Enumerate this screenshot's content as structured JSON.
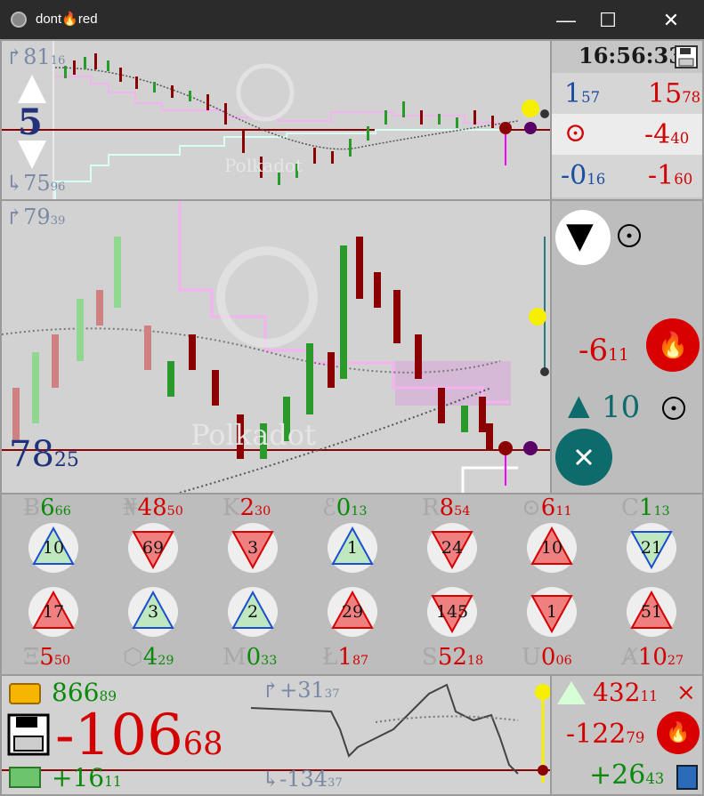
{
  "window": {
    "title": "dont🔥red",
    "controls": {
      "minimize": "—",
      "maximize": "☐",
      "close": "✕"
    }
  },
  "top_panel": {
    "hi_label": "↱81",
    "hi_sub": "16",
    "lo_label": "↳75",
    "lo_sub": "96",
    "interval": "5",
    "watermark": "Polkadot",
    "clock": "16:56:33",
    "stats": [
      {
        "a": "1",
        "a_sub": "57",
        "b": "15",
        "b_sub": "78"
      },
      {
        "a": "⊙",
        "a_sub": "",
        "b": "-4",
        "b_sub": "40"
      },
      {
        "a": "-0",
        "a_sub": "16",
        "b": "-1",
        "b_sub": "60"
      }
    ]
  },
  "main_panel": {
    "hi_label": "↱79",
    "hi_sub": "39",
    "price": "78",
    "price_sub": "25",
    "watermark": "Polkadot",
    "change": "-6",
    "change_sub": "11",
    "rank_change": "▲",
    "rank_value": "10",
    "direction_icon": "▼"
  },
  "coins": [
    {
      "sym": "Ƀ",
      "value": "6",
      "sub": "66",
      "sign": "+",
      "rank": "10",
      "color": "green",
      "dir": "up"
    },
    {
      "sym": "₦",
      "value": "48",
      "sub": "50",
      "sign": "-",
      "rank": "69",
      "color": "red",
      "dir": "down"
    },
    {
      "sym": "K",
      "value": "2",
      "sub": "30",
      "sign": "-",
      "rank": "3",
      "color": "red",
      "dir": "down"
    },
    {
      "sym": "ℰ",
      "value": "0",
      "sub": "13",
      "sign": "+",
      "rank": "1",
      "color": "green",
      "dir": "up"
    },
    {
      "sym": "R",
      "value": "8",
      "sub": "54",
      "sign": "-",
      "rank": "24",
      "color": "red",
      "dir": "down"
    },
    {
      "sym": "⊙",
      "value": "6",
      "sub": "11",
      "sign": "-",
      "rank": "10",
      "color": "red",
      "dir": "up"
    },
    {
      "sym": "C",
      "value": "1",
      "sub": "13",
      "sign": "+",
      "rank": "21",
      "color": "green",
      "dir": "down"
    },
    {
      "sym": "Ξ",
      "value": "5",
      "sub": "50",
      "sign": "-",
      "rank": "17",
      "color": "red",
      "dir": "up"
    },
    {
      "sym": "⬡",
      "value": "4",
      "sub": "29",
      "sign": "+",
      "rank": "3",
      "color": "green",
      "dir": "up"
    },
    {
      "sym": "M",
      "value": "0",
      "sub": "33",
      "sign": "+",
      "rank": "2",
      "color": "green",
      "dir": "up"
    },
    {
      "sym": "Ł",
      "value": "1",
      "sub": "87",
      "sign": "-",
      "rank": "29",
      "color": "red",
      "dir": "up"
    },
    {
      "sym": "S",
      "value": "52",
      "sub": "18",
      "sign": "-",
      "rank": "145",
      "color": "red",
      "dir": "down"
    },
    {
      "sym": "U",
      "value": "0",
      "sub": "06",
      "sign": "-",
      "rank": "1",
      "color": "red",
      "dir": "down"
    },
    {
      "sym": "Ⱥ",
      "value": "10",
      "sub": "27",
      "sign": "-",
      "rank": "51",
      "color": "red",
      "dir": "up"
    }
  ],
  "bottom_panel": {
    "balance": "866",
    "balance_sub": "89",
    "pnl": "-106",
    "pnl_sub": "68",
    "cash": "+16",
    "cash_sub": "11",
    "hi_label": "↱+31",
    "hi_sub": "37",
    "lo_label": "↳-134",
    "lo_sub": "37",
    "side_top": "432",
    "side_top_sub": "11",
    "side_mid": "-122",
    "side_mid_sub": "79",
    "side_bottom": "+26",
    "side_bottom_sub": "43",
    "close_mark": "×"
  },
  "colors": {
    "red": "#d40000",
    "green": "#0a8a0a",
    "blue": "#1a4fa0",
    "teal": "#0e6b6b",
    "pink": "#f4b3f0",
    "yellow": "#f6ef00"
  }
}
